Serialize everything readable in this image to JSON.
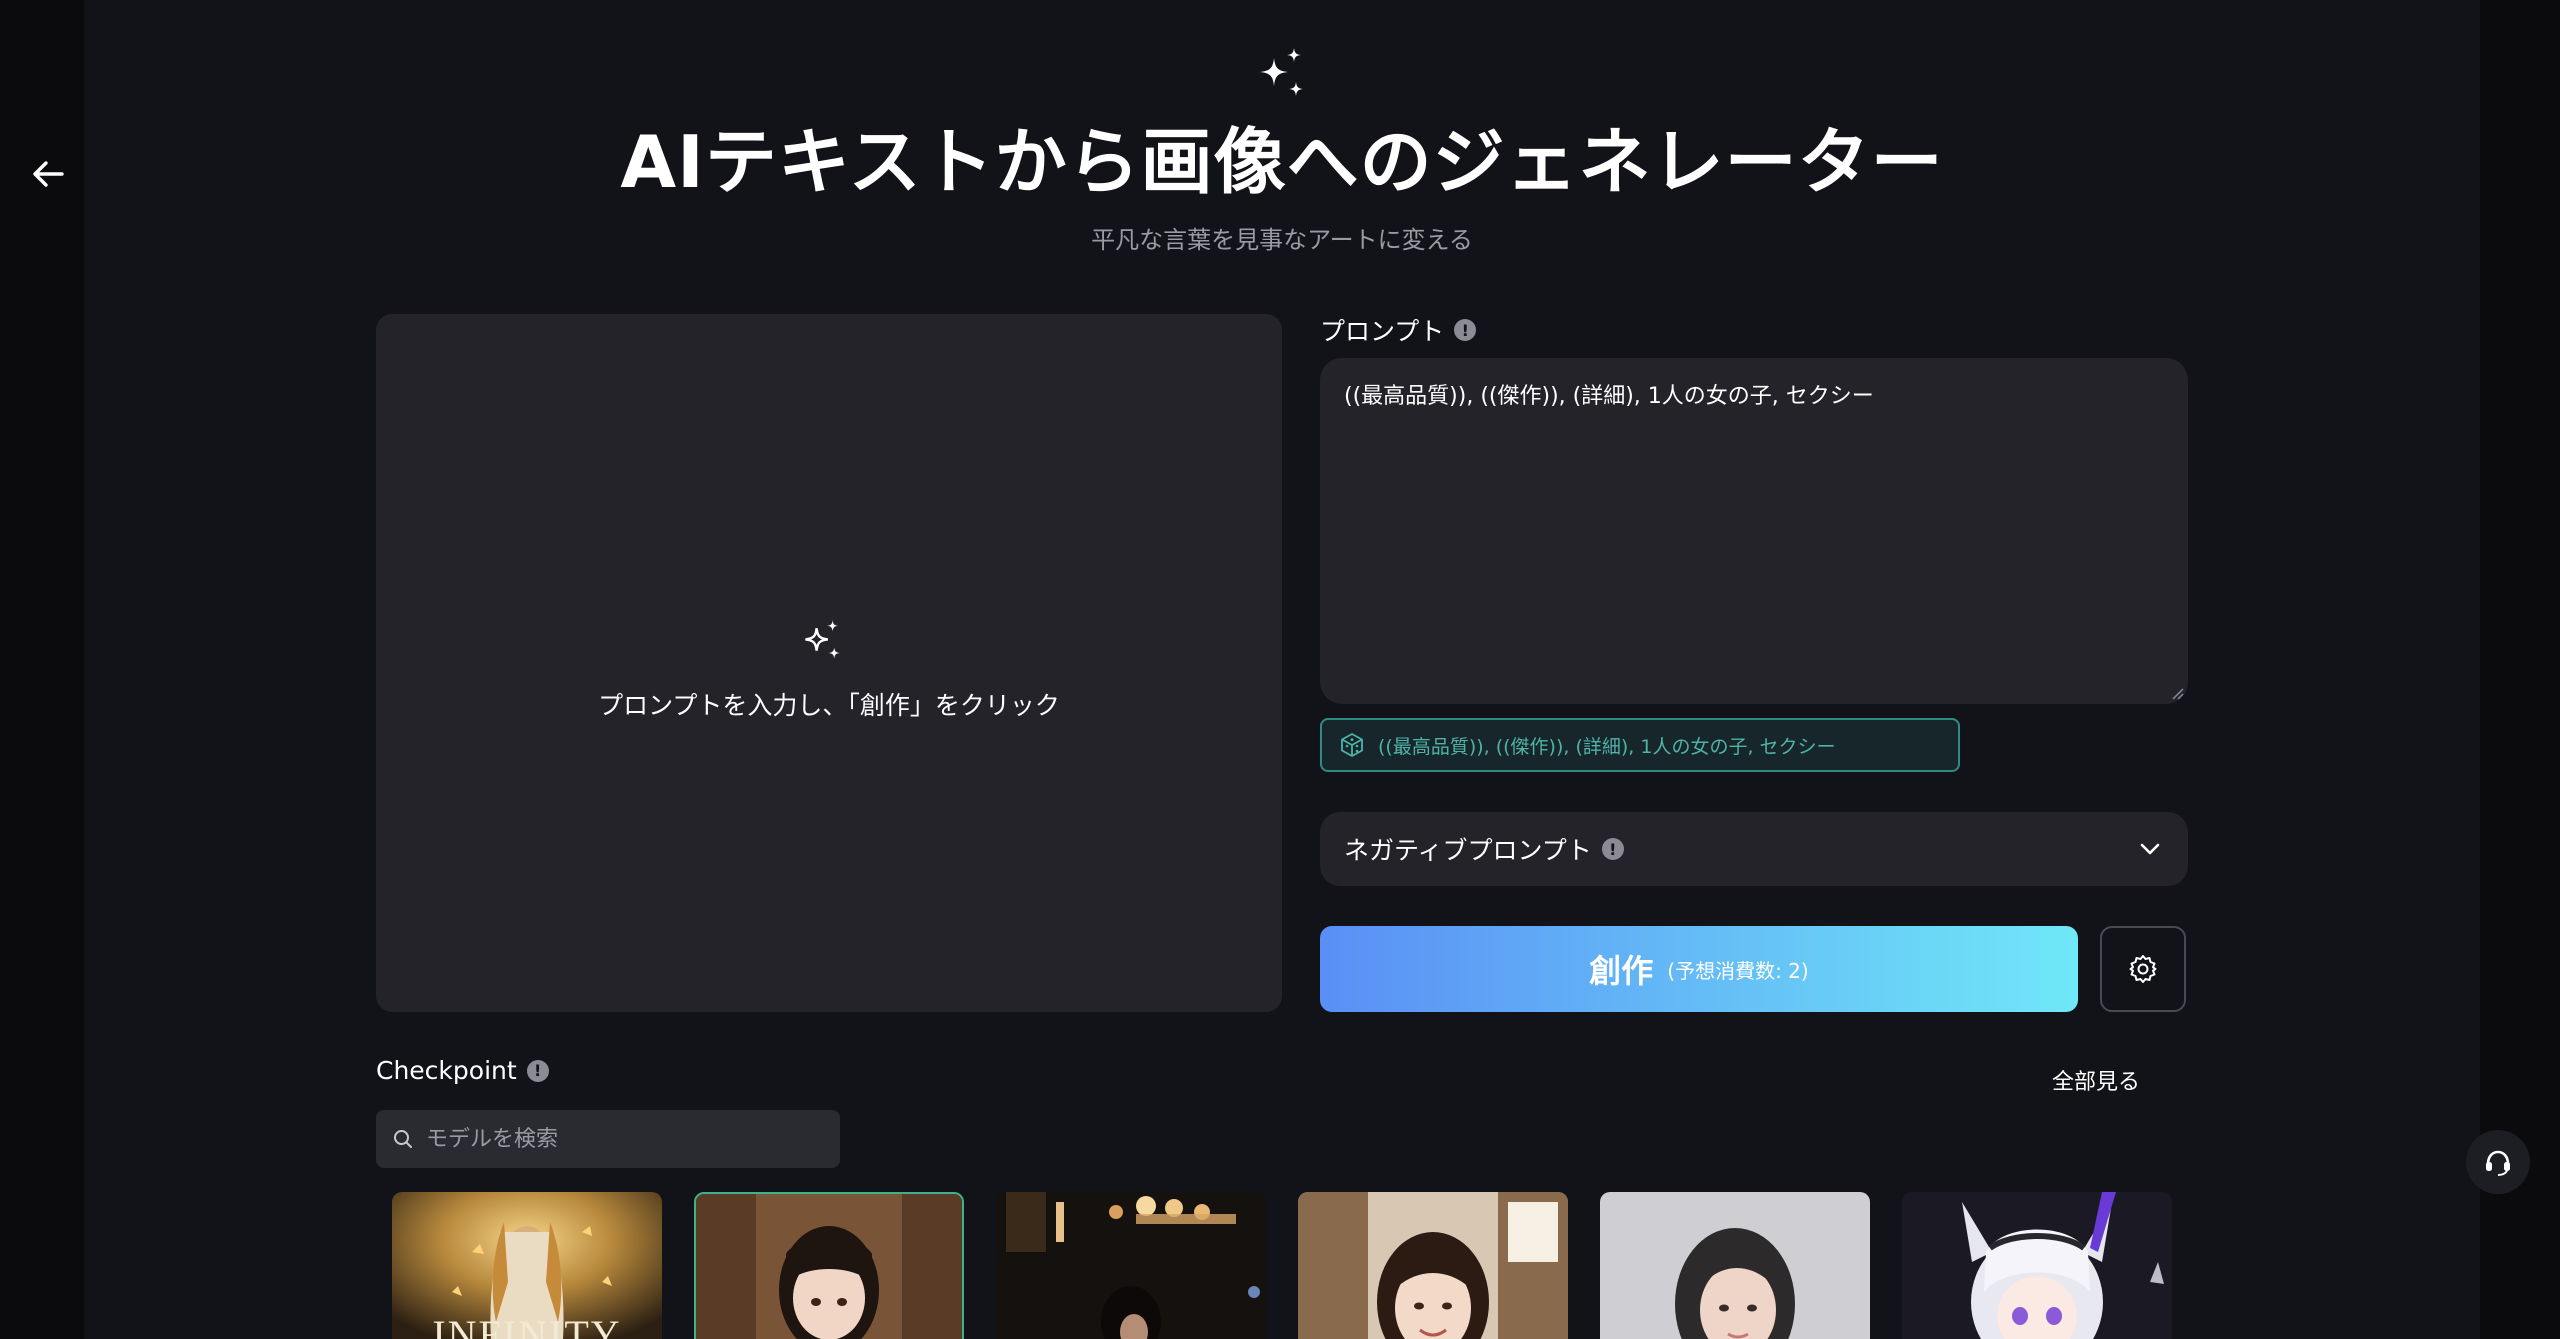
{
  "hero": {
    "title": "AIテキストから画像へのジェネレーター",
    "subtitle": "平凡な言葉を見事なアートに変える"
  },
  "preview": {
    "hint": "プロンプトを入力し、「創作」をクリック"
  },
  "prompt": {
    "label": "プロンプト",
    "value": "((最高品質)), ((傑作)), (詳細), 1人の女の子, セクシー",
    "suggestion": "((最高品質)), ((傑作)), (詳細), 1人の女の子, セクシー"
  },
  "negative": {
    "label": "ネガティブプロンプト"
  },
  "create": {
    "label": "創作",
    "estimate": "(予想消費数: 2)"
  },
  "checkpoint": {
    "label": "Checkpoint",
    "see_all": "全部見る",
    "search_placeholder": "モデルを検索",
    "models": [
      {
        "name": "infinity",
        "overlay_text": "INFINITY",
        "selected": false
      },
      {
        "name": "girl-portrait-bangs",
        "overlay_text": "",
        "selected": true
      },
      {
        "name": "city-night-portrait",
        "overlay_text": "",
        "selected": false
      },
      {
        "name": "smiling-girl-window",
        "overlay_text": "",
        "selected": false
      },
      {
        "name": "realistic-portrait",
        "overlay_text": "",
        "selected": false
      },
      {
        "name": "anime-silver-hair",
        "overlay_text": "",
        "selected": false
      }
    ]
  },
  "colors": {
    "background": "#121219",
    "panel": "#232329",
    "accent_start": "#5a8ff5",
    "accent_end": "#6fe8f7",
    "suggest_border": "#2e8c86"
  }
}
